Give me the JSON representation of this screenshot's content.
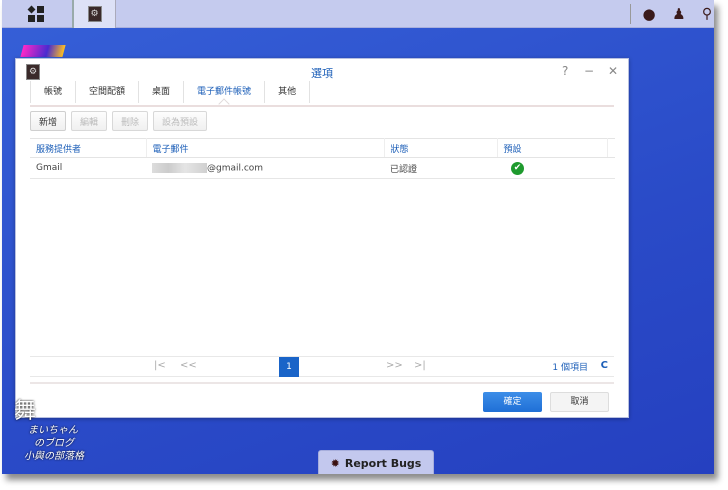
{
  "taskbar": {
    "app_icon": "settings-gears-icon",
    "right_icons": [
      "chat-icon",
      "user-icon",
      "search-icon"
    ]
  },
  "window": {
    "title": "選項",
    "help": "?",
    "minimize": "−",
    "close": "✕",
    "tabs": [
      {
        "label": "帳號"
      },
      {
        "label": "空間配額"
      },
      {
        "label": "桌面"
      },
      {
        "label": "電子郵件帳號",
        "active": true
      },
      {
        "label": "其他"
      }
    ],
    "toolbar": {
      "add": "新增",
      "edit": "編輯",
      "delete": "刪除",
      "set_default": "設為預設"
    },
    "table": {
      "headers": [
        "服務提供者",
        "電子郵件",
        "狀態",
        "預設"
      ],
      "rows": [
        {
          "provider": "Gmail",
          "email": "@gmail.com",
          "status": "已認證",
          "default_icon": "✔"
        }
      ]
    },
    "pager": {
      "first": "|<",
      "prev": "<<",
      "page": "1",
      "next": ">>",
      "last": ">|",
      "count": "1 個項目",
      "refresh": "C"
    },
    "footer": {
      "ok": "確定",
      "cancel": "取消"
    }
  },
  "report_bugs": {
    "label": "Report Bugs",
    "icon": "bug-icon"
  },
  "watermark": {
    "line1": "まいちゃん",
    "line2": "のブログ",
    "line3": "小與の部落格"
  },
  "colors": {
    "accent": "#1d5fb8",
    "desktop": "#2d4fd0",
    "success": "#1e9a2e"
  }
}
